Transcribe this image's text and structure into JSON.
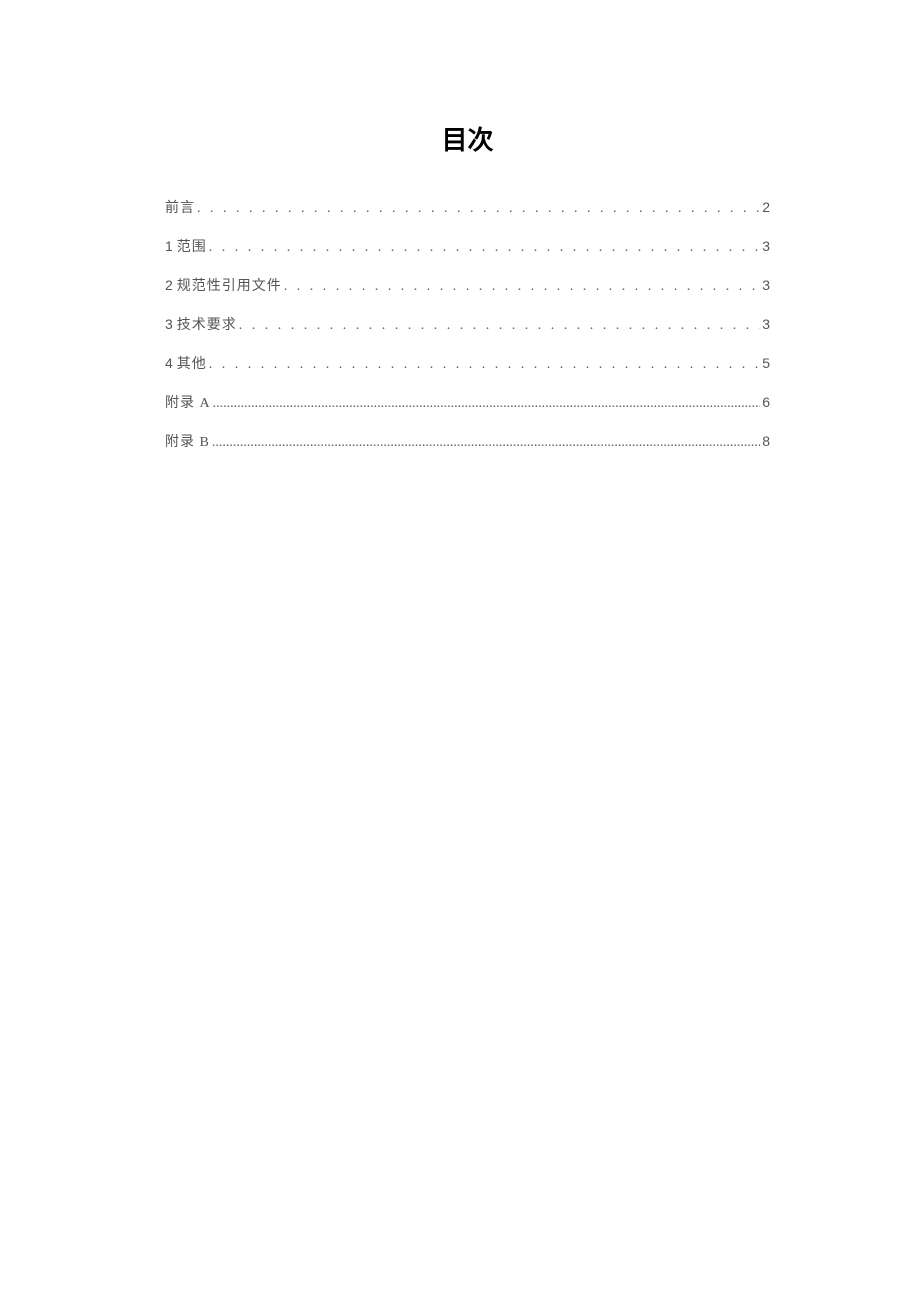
{
  "title": "目次",
  "entries": [
    {
      "label": "前言",
      "page": "2",
      "style": "wide"
    },
    {
      "num": "1",
      "label": "范围",
      "page": "3",
      "style": "wide"
    },
    {
      "num": "2",
      "label": "规范性引用文件",
      "page": "3",
      "style": "wide"
    },
    {
      "num": "3",
      "label": "技术要求",
      "page": "3",
      "style": "wide"
    },
    {
      "num": "4",
      "label": "其他",
      "page": "5",
      "style": "wide"
    },
    {
      "label": "附录 A",
      "page": "6",
      "style": "fine"
    },
    {
      "label": "附录 B",
      "page": "8",
      "style": "fine"
    }
  ]
}
